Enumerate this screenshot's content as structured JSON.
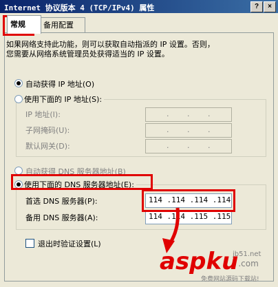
{
  "window": {
    "title": "Internet 协议版本 4 (TCP/IPv4) 属性",
    "help_button": "?",
    "close_button": "×"
  },
  "tabs": [
    {
      "label": "常规",
      "active": true
    },
    {
      "label": "备用配置",
      "active": false
    }
  ],
  "description": {
    "line1": "如果网络支持此功能，则可以获取自动指派的 IP 设置。否则，",
    "line2": "您需要从网络系统管理员处获得适当的 IP 设置。"
  },
  "ip_section": {
    "auto_label": "自动获得 IP 地址(O)",
    "manual_label": "使用下面的 IP 地址(S):",
    "selected": "auto",
    "fields": [
      {
        "label": "IP 地址(I):",
        "value": ""
      },
      {
        "label": "子网掩码(U):",
        "value": ""
      },
      {
        "label": "默认网关(D):",
        "value": ""
      }
    ]
  },
  "dns_section": {
    "auto_label": "自动获得 DNS 服务器地址(B)",
    "manual_label": "使用下面的 DNS 服务器地址(E):",
    "selected": "manual",
    "preferred_label": "首选 DNS 服务器(P):",
    "preferred_value": "114 .114 .114 .114",
    "alternate_label": "备用 DNS 服务器(A):",
    "alternate_value": "114 .114 .115 .115"
  },
  "validate": {
    "label": "退出时验证设置(L)",
    "checked": false
  },
  "watermark": {
    "site": "jb51.net",
    "logo_part1": "asp",
    "logo_part2": "ku",
    "logo_suffix": ".com",
    "tagline": "免费网站源码下载站!"
  },
  "colors": {
    "highlight": "#e00000",
    "title_bar": "#0a246a",
    "dialog_bg": "#ece9d8"
  }
}
